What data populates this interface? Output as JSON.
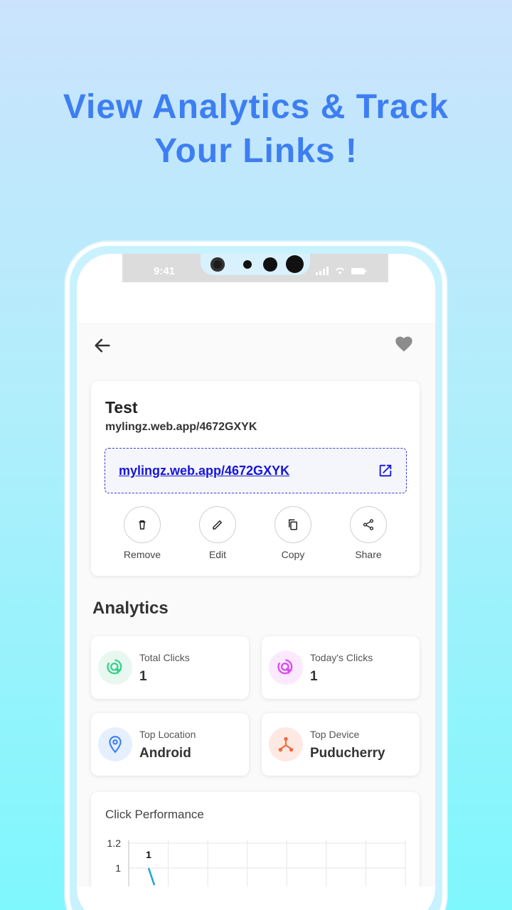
{
  "headline": {
    "line1": "View Analytics & Track",
    "line2": "Your Links !"
  },
  "status": {
    "time": "9:41"
  },
  "link": {
    "title": "Test",
    "short_url": "mylingz.web.app/4672GXYK",
    "link_text": "mylingz.web.app/4672GXYK"
  },
  "actions": [
    {
      "label": "Remove",
      "icon": "trash-icon"
    },
    {
      "label": "Edit",
      "icon": "pencil-icon"
    },
    {
      "label": "Copy",
      "icon": "copy-icon"
    },
    {
      "label": "Share",
      "icon": "share-icon"
    }
  ],
  "analytics": {
    "heading": "Analytics",
    "stats": [
      {
        "title": "Total Clicks",
        "value": "1",
        "icon": "click-icon",
        "color": "#3ccf8e",
        "bg": "#e8f8f0"
      },
      {
        "title": "Today's Clicks",
        "value": "1",
        "icon": "click-icon",
        "color": "#d94cf0",
        "bg": "#fbe9fd"
      },
      {
        "title": "Top Location",
        "value": "Android",
        "icon": "location-pin-icon",
        "color": "#3d7ef2",
        "bg": "#e6effd"
      },
      {
        "title": "Top Device",
        "value": "Puducherry",
        "icon": "device-tree-icon",
        "color": "#f26a3d",
        "bg": "#fde9e2"
      }
    ]
  },
  "chart_data": {
    "type": "line",
    "title": "Click Performance",
    "y_ticks": [
      "1.2",
      "1"
    ],
    "ylim_visible": [
      1,
      1.2
    ],
    "series": [
      {
        "values": [
          1
        ],
        "data_labels": [
          "1"
        ],
        "color": "#1ba6d6"
      }
    ]
  }
}
